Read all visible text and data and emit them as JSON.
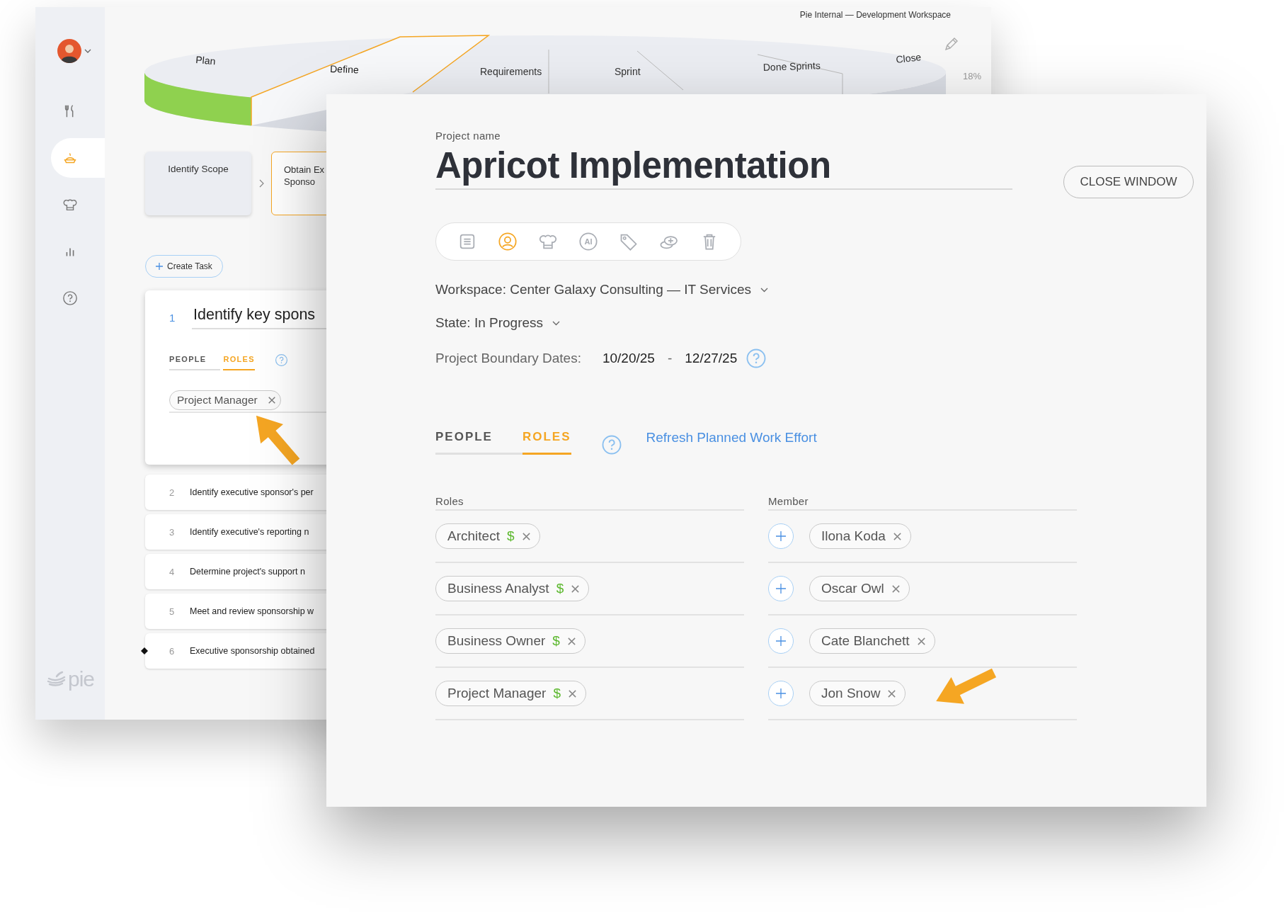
{
  "back_window": {
    "header": "Pie Internal — Development Workspace",
    "sidebar": {
      "items": [
        {
          "kind": "recipes",
          "selected": false
        },
        {
          "kind": "pies",
          "selected": true
        },
        {
          "kind": "chef",
          "selected": false
        },
        {
          "kind": "reports",
          "selected": false
        },
        {
          "kind": "help",
          "selected": false
        }
      ],
      "logo": "pie"
    },
    "phases": [
      {
        "label": "Plan",
        "done": true,
        "selected": false
      },
      {
        "label": "Define",
        "done": false,
        "selected": true
      },
      {
        "label": "Requirements",
        "done": false,
        "selected": false
      },
      {
        "label": "Sprint",
        "done": false,
        "selected": false
      },
      {
        "label": "Done Sprints",
        "done": false,
        "selected": false
      },
      {
        "label": "Close",
        "done": false,
        "selected": false
      }
    ],
    "progress": "18%",
    "stages": [
      {
        "lines": [
          "Identify Scope"
        ],
        "selected": false
      },
      {
        "lines": [
          "Obtain Ex",
          "Sponso"
        ],
        "selected": true
      }
    ],
    "create_task": "Create Task",
    "tasks": [
      {
        "number": "1",
        "title": "Identify key spons",
        "expanded": true,
        "milestone": false,
        "tabs": [
          {
            "label": "PEOPLE",
            "selected": false
          },
          {
            "label": "ROLES",
            "selected": true
          }
        ],
        "roles": [
          "Project Manager"
        ]
      },
      {
        "number": "2",
        "title": "Identify executive sponsor's per",
        "expanded": false,
        "milestone": false
      },
      {
        "number": "3",
        "title": "Identify executive's reporting n",
        "expanded": false,
        "milestone": false
      },
      {
        "number": "4",
        "title": "Determine project's support n",
        "expanded": false,
        "milestone": false
      },
      {
        "number": "5",
        "title": "Meet and review sponsorship w",
        "expanded": false,
        "milestone": false
      },
      {
        "number": "6",
        "title": "Executive sponsorship obtained",
        "expanded": false,
        "milestone": true
      }
    ]
  },
  "project": {
    "name_label": "Project name",
    "name": "Apricot Implementation",
    "close_button": "CLOSE WINDOW",
    "toolbar": [
      {
        "kind": "notes",
        "selected": false
      },
      {
        "kind": "people",
        "selected": true
      },
      {
        "kind": "chef",
        "selected": false
      },
      {
        "kind": "ai",
        "label": "AI",
        "selected": false
      },
      {
        "kind": "tags",
        "selected": false
      },
      {
        "kind": "add-coins",
        "selected": false
      },
      {
        "kind": "delete",
        "selected": false
      }
    ],
    "workspace": "Workspace: Center Galaxy Consulting — IT Services",
    "state": "State: In Progress",
    "dates_label": "Project Boundary Dates:",
    "start_date": "10/20/25",
    "date_separator": "-",
    "end_date": "12/27/25",
    "tabs": [
      {
        "label": "PEOPLE",
        "selected": false
      },
      {
        "label": "ROLES",
        "selected": true
      }
    ],
    "refresh_link": "Refresh Planned Work Effort",
    "columns": [
      "Roles",
      "Member"
    ],
    "roles": [
      {
        "name": "Architect",
        "billing_mark": "$"
      },
      {
        "name": "Business Analyst",
        "billing_mark": "$"
      },
      {
        "name": "Business Owner",
        "billing_mark": "$"
      },
      {
        "name": "Project Manager",
        "billing_mark": "$"
      }
    ],
    "members": [
      "Ilona Koda",
      "Oscar Owl",
      "Cate Blanchett",
      "Jon Snow"
    ]
  }
}
